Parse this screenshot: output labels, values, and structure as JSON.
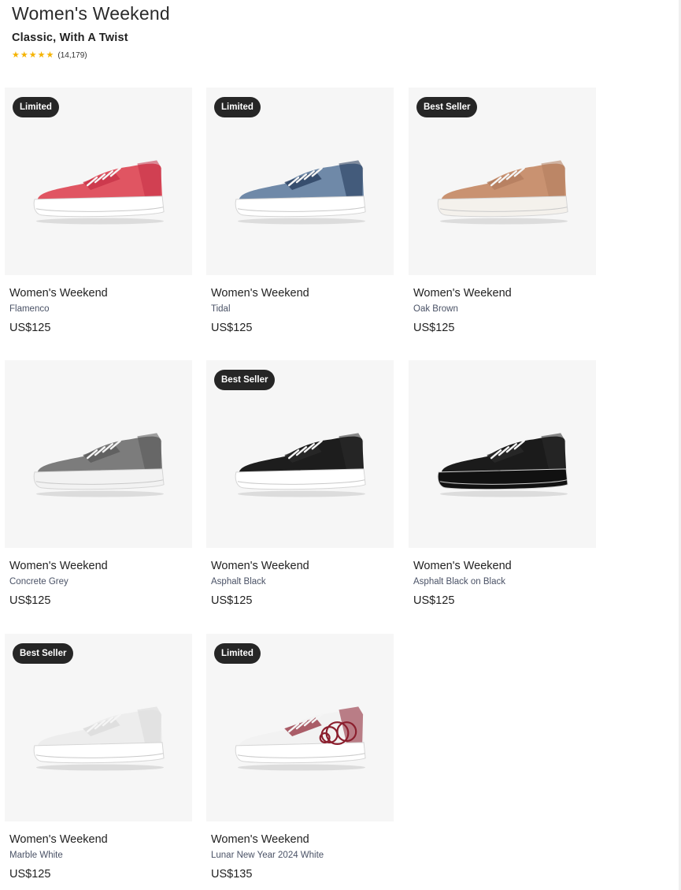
{
  "header": {
    "title": "Women's Weekend",
    "subtitle": "Classic, With A Twist",
    "rating_count": "(14,179)",
    "stars": 5
  },
  "products": [
    {
      "badge": "Limited",
      "name": "Women's Weekend",
      "color": "Flamenco",
      "price": "US$125",
      "upper": "#e05562",
      "sole": "#ffffff",
      "accent": "#c52f45"
    },
    {
      "badge": "Limited",
      "name": "Women's Weekend",
      "color": "Tidal",
      "price": "US$125",
      "upper": "#6f89a8",
      "sole": "#ffffff",
      "accent": "#1f3456"
    },
    {
      "badge": "Best Seller",
      "name": "Women's Weekend",
      "color": "Oak Brown",
      "price": "US$125",
      "upper": "#c99271",
      "sole": "#f4f1ec",
      "accent": "#b07b5c"
    },
    {
      "badge": "",
      "name": "Women's Weekend",
      "color": "Concrete Grey",
      "price": "US$125",
      "upper": "#7c7c7c",
      "sole": "#f2f2f2",
      "accent": "#555555"
    },
    {
      "badge": "Best Seller",
      "name": "Women's Weekend",
      "color": "Asphalt Black",
      "price": "US$125",
      "upper": "#1d1d1d",
      "sole": "#ffffff",
      "accent": "#2b2b2b"
    },
    {
      "badge": "",
      "name": "Women's Weekend",
      "color": "Asphalt Black on Black",
      "price": "US$125",
      "upper": "#1b1b1b",
      "sole": "#111111",
      "accent": "#2b2b2b"
    },
    {
      "badge": "Best Seller",
      "name": "Women's Weekend",
      "color": "Marble White",
      "price": "US$125",
      "upper": "#ededed",
      "sole": "#ffffff",
      "accent": "#d8d8d8"
    },
    {
      "badge": "Limited",
      "name": "Women's Weekend",
      "color": "Lunar New Year 2024 White",
      "price": "US$135",
      "upper": "#f2f2f2",
      "sole": "#ffffff",
      "accent": "#8b1e2d"
    }
  ]
}
